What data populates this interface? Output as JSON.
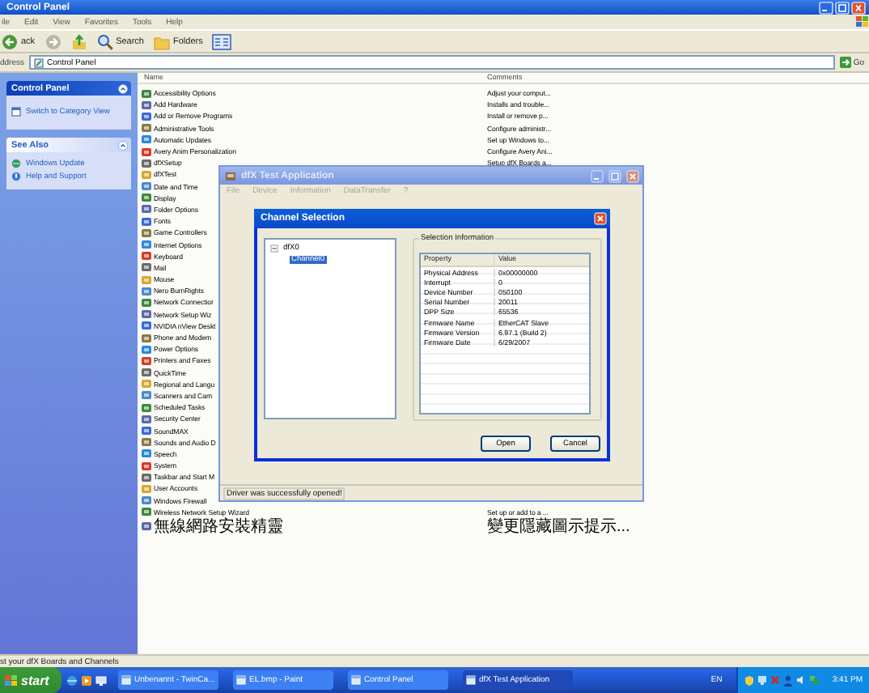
{
  "window": {
    "title": "Control Panel"
  },
  "menu": [
    "ile",
    "Edit",
    "View",
    "Favorites",
    "Tools",
    "Help"
  ],
  "toolbar": [
    {
      "kind": "back",
      "label": "ack"
    },
    {
      "kind": "forward"
    },
    {
      "kind": "up"
    },
    {
      "kind": "search",
      "label": "Search"
    },
    {
      "kind": "folders",
      "label": "Folders"
    },
    {
      "kind": "views"
    }
  ],
  "address": {
    "label": "ddress",
    "value": "Control Panel",
    "go": "Go"
  },
  "sidebar": {
    "panels": [
      {
        "title": "Control Panel",
        "links": [
          "Switch to Category View"
        ]
      },
      {
        "title": "See Also",
        "links": [
          "Windows Update",
          "Help and Support"
        ]
      }
    ]
  },
  "list": {
    "columns": [
      "Name",
      "Comments"
    ],
    "rows": [
      {
        "name": "Accessibility Options",
        "comment": "Adjust your comput..."
      },
      {
        "name": "Add Hardware",
        "comment": "Installs and trouble..."
      },
      {
        "name": "Add or Remove Programs",
        "comment": "Install or remove p..."
      },
      {
        "name": "Administrative Tools",
        "comment": "Configure administr..."
      },
      {
        "name": "Automatic Updates",
        "comment": "Set up Windows to..."
      },
      {
        "name": "Avery Anim Personalization",
        "comment": "Configure Avery Ani..."
      },
      {
        "name": "dfXSetup",
        "comment": "Setup dfX Boards a..."
      },
      {
        "name": "dfXTest"
      },
      {
        "name": "Date and Time"
      },
      {
        "name": "Display"
      },
      {
        "name": "Folder Options"
      },
      {
        "name": "Fonts"
      },
      {
        "name": "Game Controllers"
      },
      {
        "name": "Internet Options"
      },
      {
        "name": "Keyboard"
      },
      {
        "name": "Mail"
      },
      {
        "name": "Mouse"
      },
      {
        "name": "Nero BurnRights"
      },
      {
        "name": "Network Connectior"
      },
      {
        "name": "Network Setup Wiz"
      },
      {
        "name": "NVIDIA nView Deskt"
      },
      {
        "name": "Phone and Modem"
      },
      {
        "name": "Power Options"
      },
      {
        "name": "Printers and Faxes"
      },
      {
        "name": "QuickTime"
      },
      {
        "name": "Regional and Langu"
      },
      {
        "name": "Scanners and Cam"
      },
      {
        "name": "Scheduled Tasks"
      },
      {
        "name": "Security Center"
      },
      {
        "name": "SoundMAX"
      },
      {
        "name": "Sounds and Audio D"
      },
      {
        "name": "Speech"
      },
      {
        "name": "System"
      },
      {
        "name": "Taskbar and Start M"
      },
      {
        "name": "User Accounts"
      },
      {
        "name": "Windows Firewall"
      },
      {
        "name": "Wireless Network Setup Wizard",
        "comment": "Set up or add to a ..."
      },
      {
        "name": "無線網路安裝精靈",
        "comment": "變更隱藏圖示提示..."
      }
    ]
  },
  "status_bar": "st your dfX Boards and Channels",
  "app_window": {
    "title": "dfX Test Application",
    "menu": [
      "File",
      "Device",
      "Information",
      "DataTransfer",
      "?"
    ],
    "status": "Driver was successfully opened!",
    "dialog": {
      "title": "Channel Selection",
      "tree": [
        {
          "label": "dfX0",
          "expanded": true,
          "selected": false,
          "children": [
            {
              "label": "Channel0",
              "selected": true
            }
          ]
        }
      ],
      "group": "Selection Information",
      "columns": [
        "Property",
        "Value"
      ],
      "rows": [
        [
          "Physical Address",
          "0x00000000"
        ],
        [
          "Interrupt",
          "0"
        ],
        [
          "Device Number",
          "050100"
        ],
        [
          "Serial Number",
          "20011"
        ],
        [
          "DPP Size",
          "65536"
        ],
        [
          "Firmware Name",
          "EtherCAT Slave"
        ],
        [
          "Firmware Version",
          "6.97.1 (Build 2)"
        ],
        [
          "Firmware Date",
          "6/29/2007"
        ]
      ],
      "buttons": [
        "Open",
        "Cancel"
      ]
    }
  },
  "taskbar": {
    "start": "start",
    "tasks": [
      {
        "label": "Unbenannt - TwinCa...",
        "active": false
      },
      {
        "label": "EL.bmp - Paint",
        "active": false
      },
      {
        "label": "Control Panel",
        "active": false
      },
      {
        "label": "dfX Test Application",
        "active": true
      }
    ],
    "language": "EN",
    "clock": "3:41 PM"
  }
}
